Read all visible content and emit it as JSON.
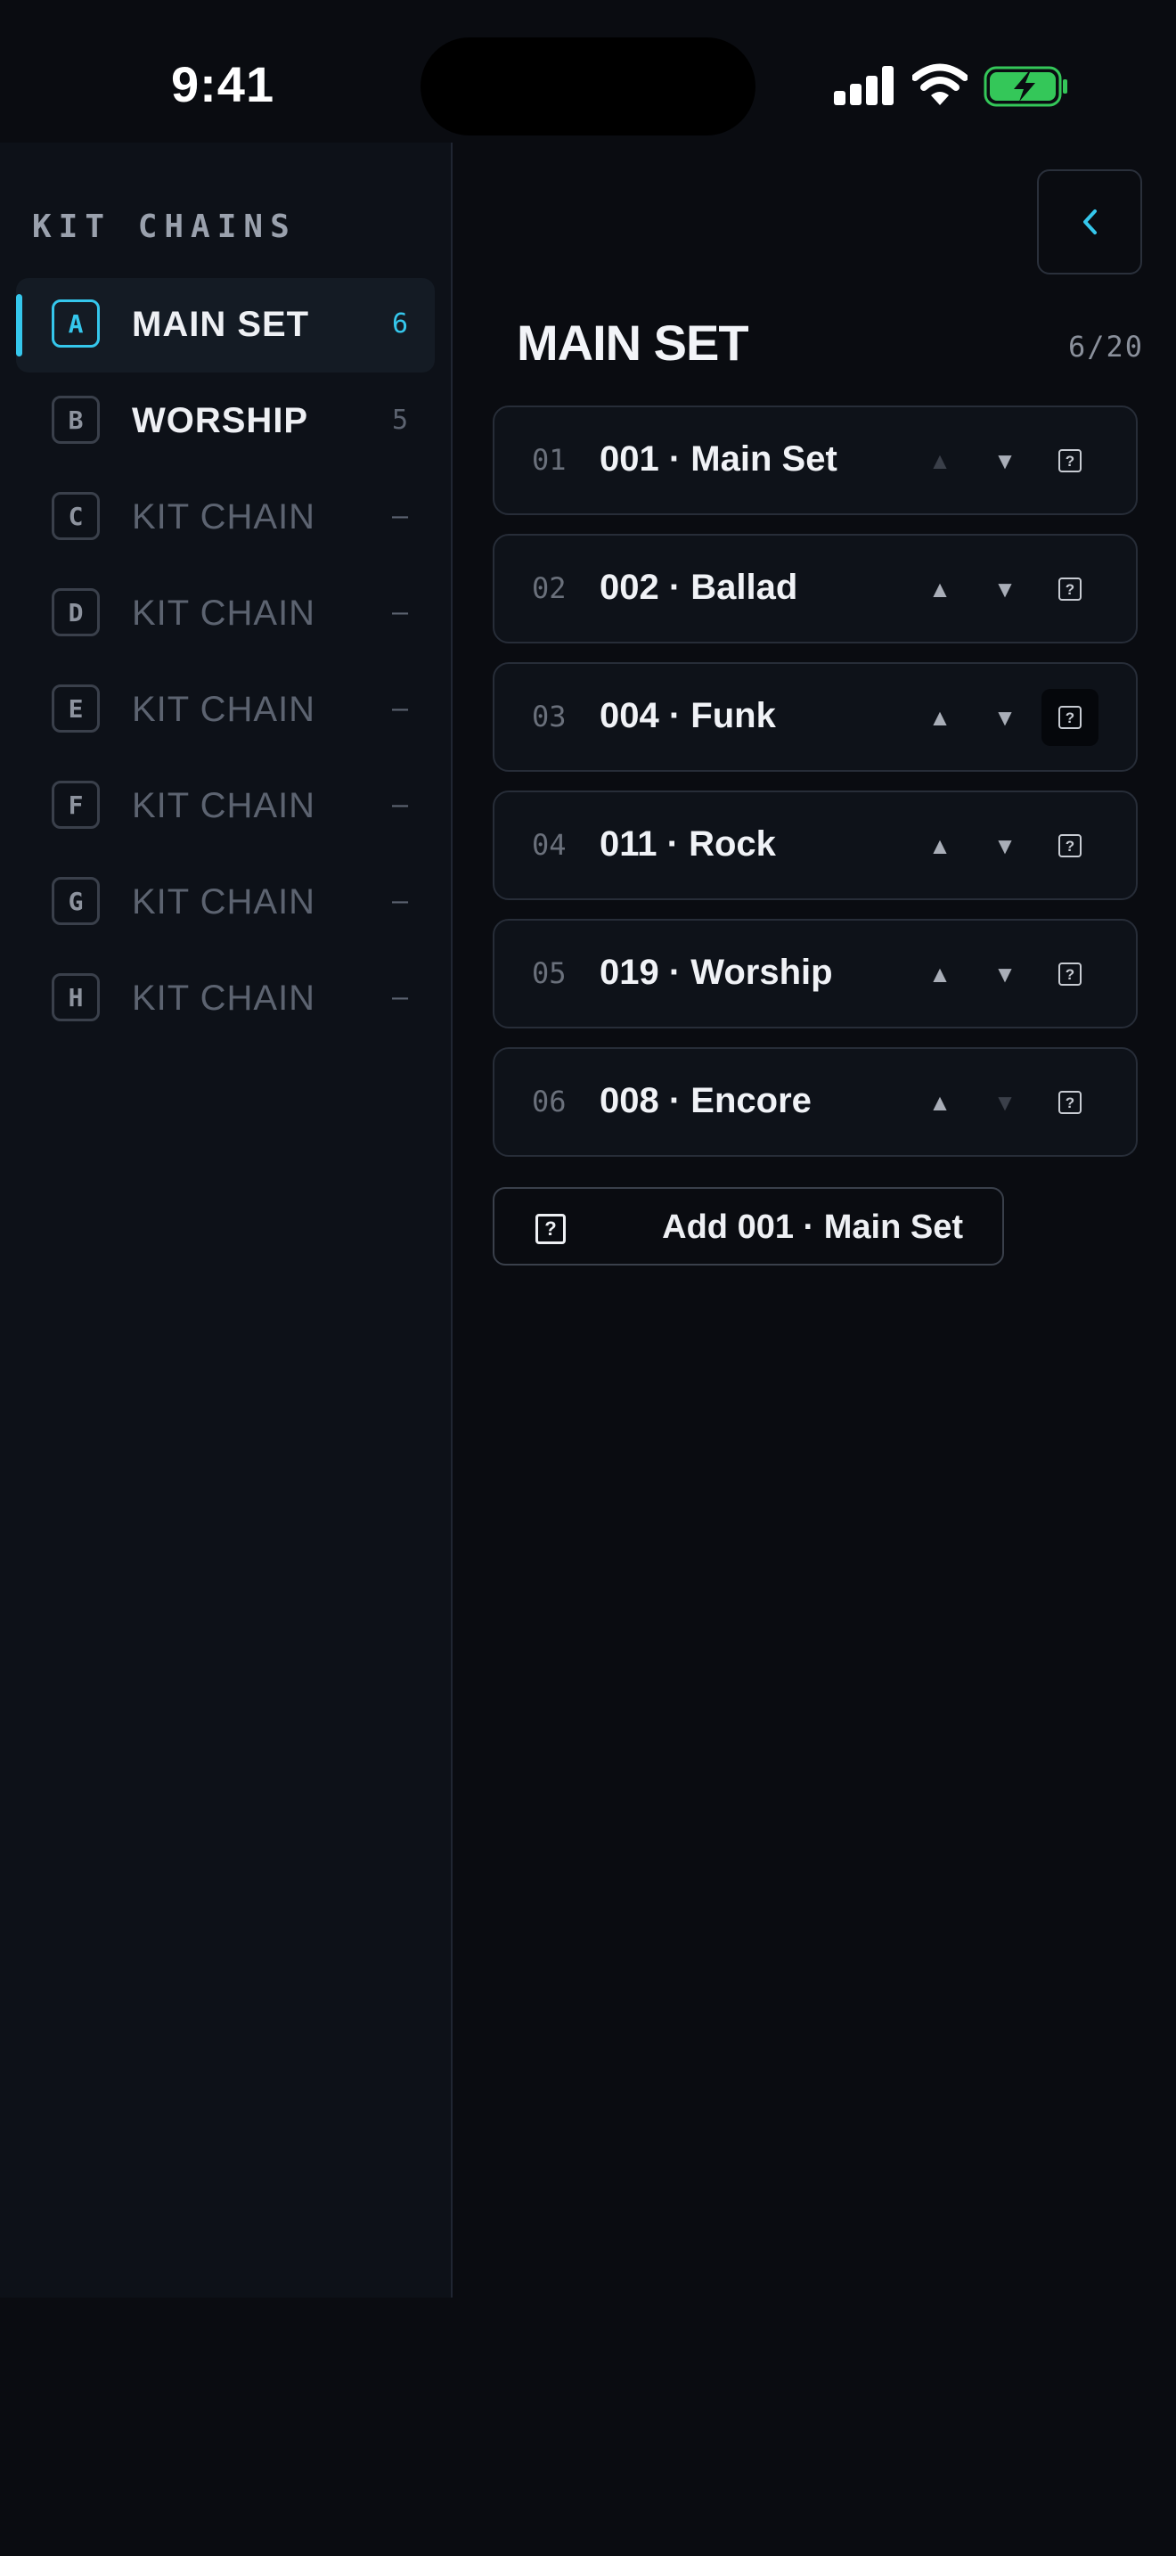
{
  "status_bar": {
    "time": "9:41"
  },
  "sidebar": {
    "heading": "KIT CHAINS",
    "items": [
      {
        "letter": "A",
        "label": "MAIN SET",
        "count": "6",
        "active": true
      },
      {
        "letter": "B",
        "label": "WORSHIP",
        "count": "5",
        "active": false
      },
      {
        "letter": "C",
        "label": "KIT CHAIN",
        "count": "–",
        "active": false
      },
      {
        "letter": "D",
        "label": "KIT CHAIN",
        "count": "–",
        "active": false
      },
      {
        "letter": "E",
        "label": "KIT CHAIN",
        "count": "–",
        "active": false
      },
      {
        "letter": "F",
        "label": "KIT CHAIN",
        "count": "–",
        "active": false
      },
      {
        "letter": "G",
        "label": "KIT CHAIN",
        "count": "–",
        "active": false
      },
      {
        "letter": "H",
        "label": "KIT CHAIN",
        "count": "–",
        "active": false
      }
    ]
  },
  "header": {
    "collapse_icon": "chevron-left-icon"
  },
  "main": {
    "title": "MAIN SET",
    "count": "6/20",
    "rows": [
      {
        "index": "01",
        "name": "001 · Main Set"
      },
      {
        "index": "02",
        "name": "002 · Ballad"
      },
      {
        "index": "03",
        "name": "004 · Funk"
      },
      {
        "index": "04",
        "name": "011 · Rock"
      },
      {
        "index": "05",
        "name": "019 · Worship"
      },
      {
        "index": "06",
        "name": "008 · Encore"
      }
    ],
    "action_icon_glyph": "?",
    "add_label": "Add 001 · Main Set"
  },
  "colors": {
    "accent": "#35c7ec",
    "background": "#0a0c11",
    "sidebar": "#0d1118",
    "battery": "#34c759"
  }
}
